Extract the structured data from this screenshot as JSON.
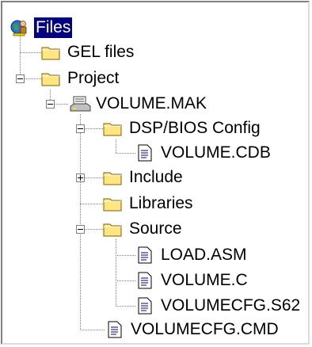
{
  "tree": {
    "root": {
      "label": "Files",
      "icon": "globe-person-icon",
      "selected": true
    },
    "gel_files": {
      "label": "GEL files",
      "icon": "folder-icon"
    },
    "project": {
      "label": "Project",
      "icon": "folder-icon",
      "expanded": true
    },
    "volume_mak": {
      "label": "VOLUME.MAK",
      "icon": "project-file-icon",
      "expanded": true
    },
    "dsp_bios_config": {
      "label": "DSP/BIOS Config",
      "icon": "folder-icon",
      "expanded": true
    },
    "volume_cdb": {
      "label": "VOLUME.CDB",
      "icon": "document-icon"
    },
    "include": {
      "label": "Include",
      "icon": "folder-icon",
      "expanded": false
    },
    "libraries": {
      "label": "Libraries",
      "icon": "folder-icon"
    },
    "source": {
      "label": "Source",
      "icon": "folder-icon",
      "expanded": true
    },
    "load_asm": {
      "label": "LOAD.ASM",
      "icon": "document-icon"
    },
    "volume_c": {
      "label": "VOLUME.C",
      "icon": "document-icon"
    },
    "volumecfg_s62": {
      "label": "VOLUMECFG.S62",
      "icon": "document-icon"
    },
    "volumecfg_cmd": {
      "label": "VOLUMECFG.CMD",
      "icon": "document-icon"
    }
  },
  "colors": {
    "selection": "#000080",
    "folder": "#ffe680",
    "tree_lines": "#808080"
  }
}
